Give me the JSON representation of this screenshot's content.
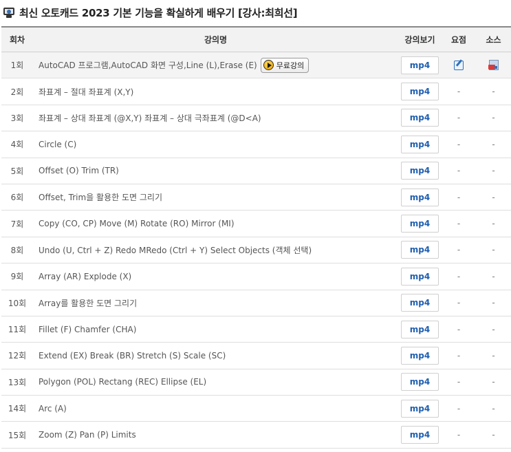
{
  "page": {
    "title": "최신 오토캐드 2023 기본 기능을 확실하게 배우기 [강사:최희선]"
  },
  "table": {
    "headers": {
      "num": "회차",
      "title": "강의명",
      "view": "강의보기",
      "summary": "요점",
      "source": "소스"
    },
    "free_button_label": "무료강의",
    "rows": [
      {
        "num": "1회",
        "title": "AutoCAD 프로그램,AutoCAD 화면 구성,Line (L),Erase (E)",
        "view": "mp4",
        "summary": "",
        "source": ""
      },
      {
        "num": "2회",
        "title": "좌표계 – 절대 좌표계 (X,Y)",
        "view": "mp4",
        "summary": "-",
        "source": "-"
      },
      {
        "num": "3회",
        "title": "좌표계 – 상대 좌표계 (@X,Y) 좌표계 – 상대 극좌표계 (@D<A)",
        "view": "mp4",
        "summary": "-",
        "source": "-"
      },
      {
        "num": "4회",
        "title": "Circle (C)",
        "view": "mp4",
        "summary": "-",
        "source": "-"
      },
      {
        "num": "5회",
        "title": "Offset (O) Trim (TR)",
        "view": "mp4",
        "summary": "-",
        "source": "-"
      },
      {
        "num": "6회",
        "title": "Offset, Trim을 활용한 도면 그리기",
        "view": "mp4",
        "summary": "-",
        "source": "-"
      },
      {
        "num": "7회",
        "title": "Copy (CO, CP) Move (M) Rotate (RO) Mirror (MI)",
        "view": "mp4",
        "summary": "-",
        "source": "-"
      },
      {
        "num": "8회",
        "title": "Undo (U, Ctrl + Z) Redo MRedo (Ctrl + Y) Select Objects (객체 선택)",
        "view": "mp4",
        "summary": "-",
        "source": "-"
      },
      {
        "num": "9회",
        "title": "Array (AR) Explode (X)",
        "view": "mp4",
        "summary": "-",
        "source": "-"
      },
      {
        "num": "10회",
        "title": "Array를 활용한 도면 그리기",
        "view": "mp4",
        "summary": "-",
        "source": "-"
      },
      {
        "num": "11회",
        "title": "Fillet (F) Chamfer (CHA)",
        "view": "mp4",
        "summary": "-",
        "source": "-"
      },
      {
        "num": "12회",
        "title": "Extend (EX) Break (BR) Stretch (S) Scale (SC)",
        "view": "mp4",
        "summary": "-",
        "source": "-"
      },
      {
        "num": "13회",
        "title": "Polygon (POL) Rectang (REC) Ellipse (EL)",
        "view": "mp4",
        "summary": "-",
        "source": "-"
      },
      {
        "num": "14회",
        "title": "Arc (A)",
        "view": "mp4",
        "summary": "-",
        "source": "-"
      },
      {
        "num": "15회",
        "title": "Zoom (Z) Pan (P) Limits",
        "view": "mp4",
        "summary": "-",
        "source": "-"
      }
    ]
  },
  "icons": {
    "title": "monitor-icon",
    "free": "play-icon",
    "summary": "edit-icon",
    "source": "file-icon"
  },
  "colors": {
    "mp4_text": "#1f5fb0",
    "header_bg": "#f2f2f2",
    "first_row_bg": "#f4f4f4"
  }
}
